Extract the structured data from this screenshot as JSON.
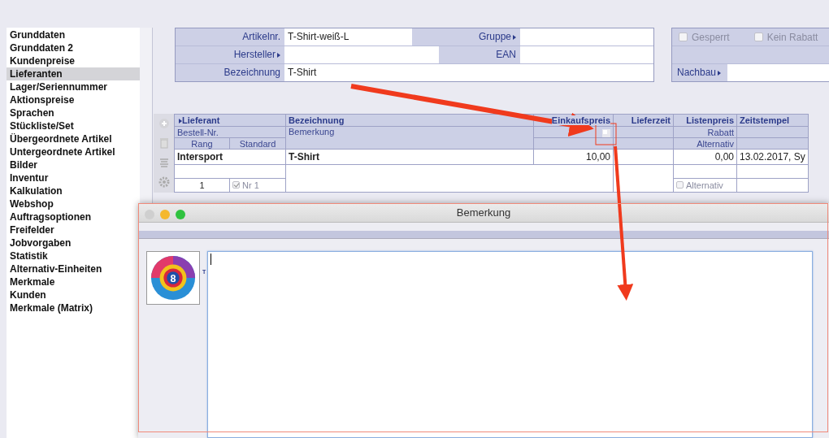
{
  "sidebar": {
    "items": [
      {
        "label": "Grunddaten",
        "selected": false
      },
      {
        "label": "Grunddaten 2",
        "selected": false
      },
      {
        "label": "Kundenpreise",
        "selected": false
      },
      {
        "label": "Lieferanten",
        "selected": true
      },
      {
        "label": "Lager/Seriennummer",
        "selected": false
      },
      {
        "label": "Aktionspreise",
        "selected": false
      },
      {
        "label": "Sprachen",
        "selected": false
      },
      {
        "label": "Stückliste/Set",
        "selected": false
      },
      {
        "label": "Übergeordnete Artikel",
        "selected": false
      },
      {
        "label": "Untergeordnete Artikel",
        "selected": false
      },
      {
        "label": "Bilder",
        "selected": false
      },
      {
        "label": "Inventur",
        "selected": false
      },
      {
        "label": "Kalkulation",
        "selected": false
      },
      {
        "label": "Webshop",
        "selected": false
      },
      {
        "label": "Auftragsoptionen",
        "selected": false
      },
      {
        "label": "Freifelder",
        "selected": false
      },
      {
        "label": "Jobvorgaben",
        "selected": false
      },
      {
        "label": "Statistik",
        "selected": false
      },
      {
        "label": "Alternativ-Einheiten",
        "selected": false
      },
      {
        "label": "Merkmale",
        "selected": false
      },
      {
        "label": "Kunden",
        "selected": false
      },
      {
        "label": "Merkmale (Matrix)",
        "selected": false
      }
    ]
  },
  "article_form": {
    "rows": [
      [
        {
          "label": "Artikelnr.",
          "link": false,
          "value": "T-Shirt-weiß-L"
        },
        {
          "label": "Gruppe",
          "link": true
        }
      ],
      [
        {
          "label": "Hersteller",
          "link": true
        },
        {
          "label": "EAN",
          "link": false
        }
      ],
      [
        {
          "label": "Bezeichnung",
          "link": false,
          "value": "T-Shirt"
        }
      ]
    ]
  },
  "flags_panel": {
    "checkboxes": [
      {
        "label": "Gesperrt",
        "checked": false
      },
      {
        "label": "Kein Rabatt",
        "checked": false
      }
    ],
    "field": {
      "label": "Nachbau",
      "link": true
    }
  },
  "supplier_table": {
    "header": {
      "lieferant": "Lieferant",
      "bestell_nr": "Bestell-Nr.",
      "rang": "Rang",
      "standard": "Standard",
      "bezeichnung": "Bezeichnung",
      "bemerkung": "Bemerkung",
      "einkaufspreis": "Einkaufspreis",
      "lieferzeit": "Lieferzeit",
      "listenpreis": "Listenpreis",
      "rabatt": "Rabatt",
      "alternativ": "Alternativ",
      "zeitstempel": "Zeitstempel"
    },
    "rows": [
      {
        "lieferant": "Intersport",
        "bezeichnung": "T-Shirt",
        "einkaufspreis": "10,00",
        "listenpreis": "0,00",
        "zeitstempel": "13.02.2017, Sy",
        "rang": "1",
        "standard": {
          "label": "Nr 1",
          "checked": true
        },
        "alternativ": {
          "label": "Alternativ",
          "checked": false
        }
      }
    ]
  },
  "dialog": {
    "title": "Bemerkung",
    "logo_text": "8",
    "marker": "T"
  }
}
